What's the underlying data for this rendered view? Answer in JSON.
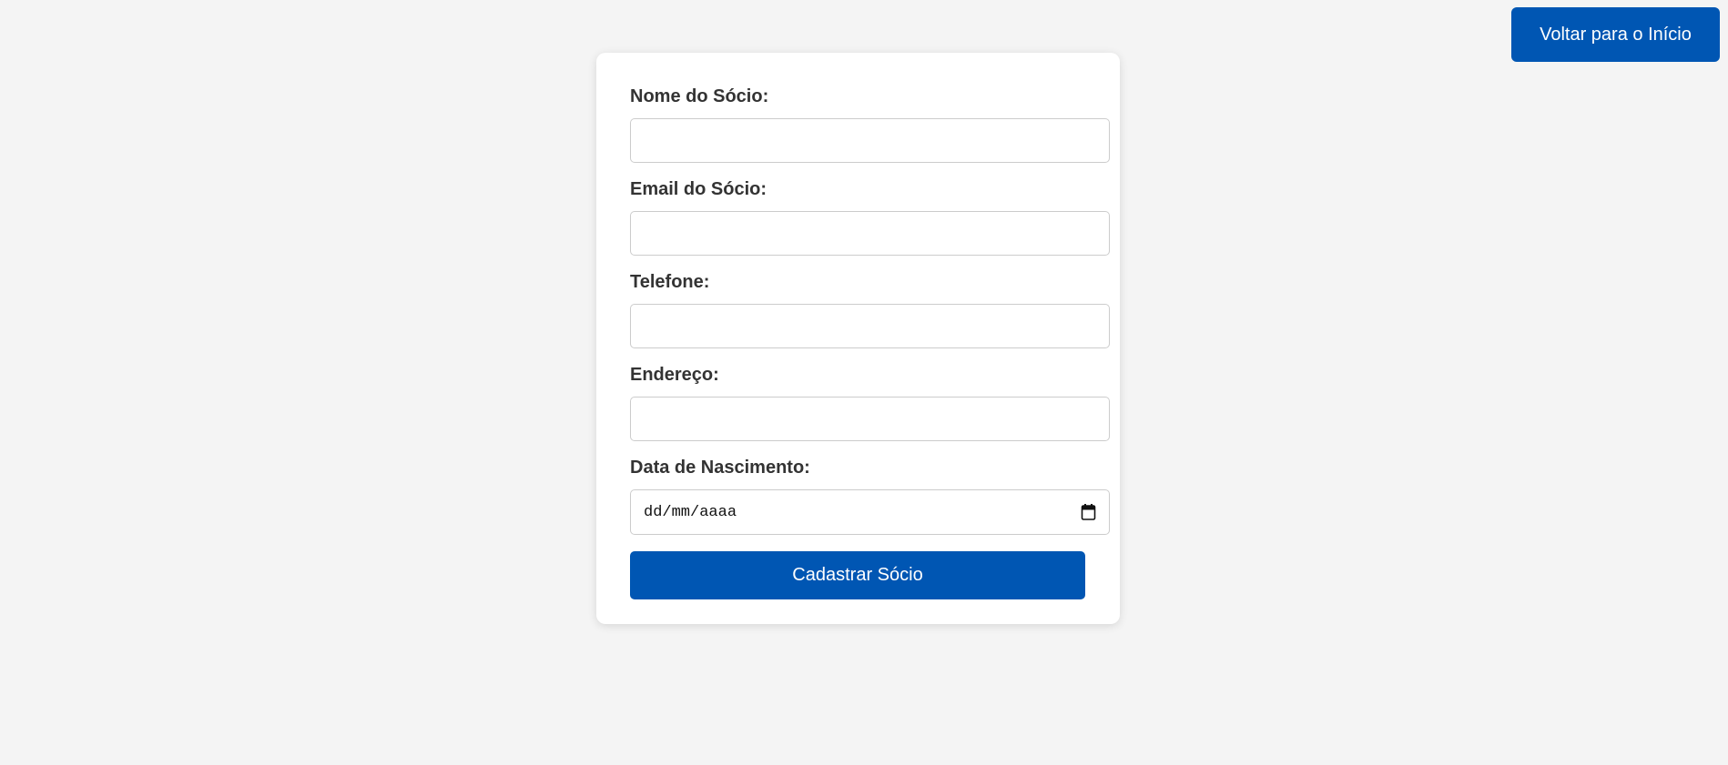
{
  "header": {
    "back_button_label": "Voltar para o Início"
  },
  "form": {
    "fields": [
      {
        "label": "Nome do Sócio:",
        "value": "",
        "placeholder": ""
      },
      {
        "label": "Email do Sócio:",
        "value": "",
        "placeholder": ""
      },
      {
        "label": "Telefone:",
        "value": "",
        "placeholder": ""
      },
      {
        "label": "Endereço:",
        "value": "",
        "placeholder": ""
      }
    ],
    "birth_date": {
      "label": "Data de Nascimento:",
      "placeholder": "dd/mm/aaaa",
      "icon": "calendar-icon"
    },
    "submit_label": "Cadastrar Sócio"
  },
  "colors": {
    "accent": "#0056b3",
    "background": "#f4f4f4",
    "card": "#ffffff",
    "label_text": "#333333"
  }
}
